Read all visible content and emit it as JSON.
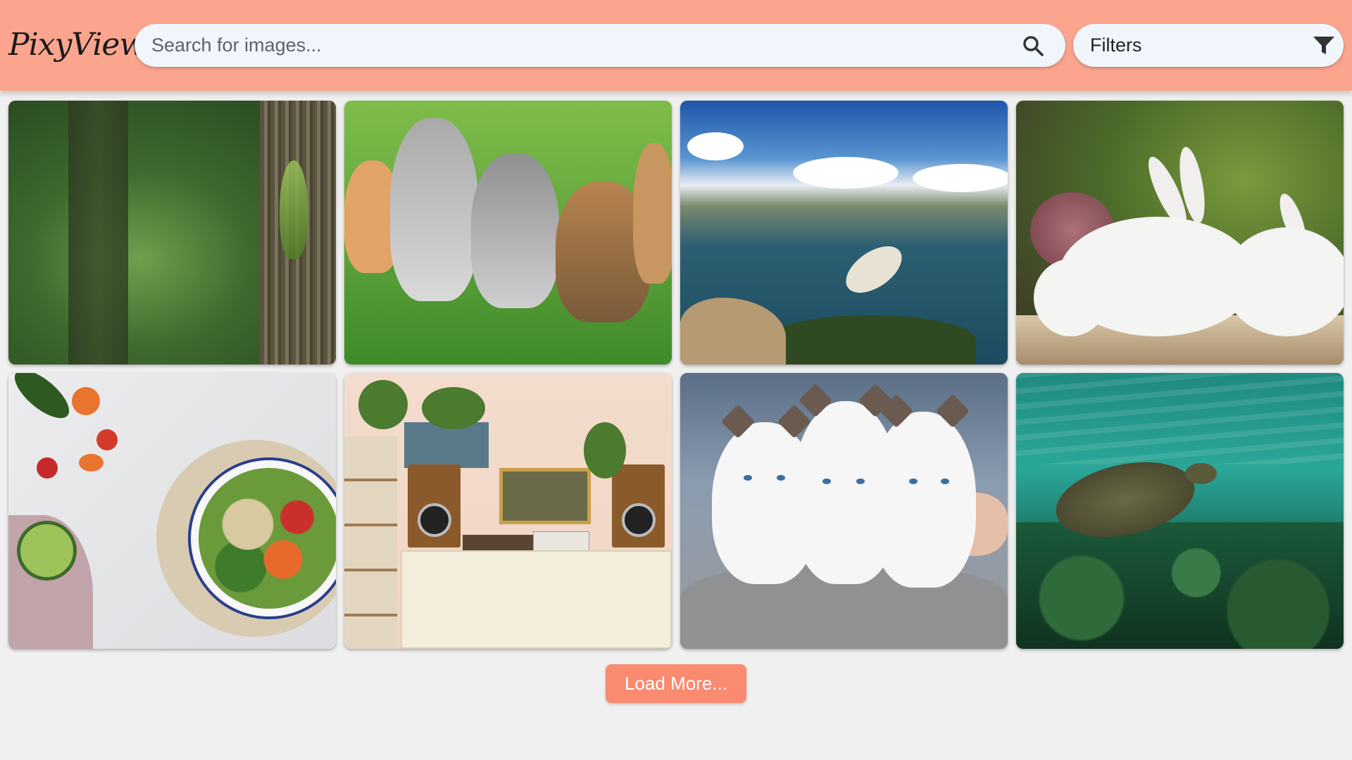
{
  "header": {
    "logo_text": "PixyView",
    "background_color": "#fca58e",
    "search": {
      "placeholder": "Search for images...",
      "value": "",
      "icon": "search-icon"
    },
    "filters": {
      "label": "Filters",
      "icon": "filter-icon"
    }
  },
  "gallery": {
    "images": [
      {
        "subject": "forest"
      },
      {
        "subject": "kittens on grass"
      },
      {
        "subject": "coastline"
      },
      {
        "subject": "white rabbits"
      },
      {
        "subject": "salad bowl"
      },
      {
        "subject": "living room"
      },
      {
        "subject": "white kittens"
      },
      {
        "subject": "sea turtle"
      }
    ]
  },
  "load_more": {
    "label": "Load More...",
    "color": "#fa8a70"
  }
}
